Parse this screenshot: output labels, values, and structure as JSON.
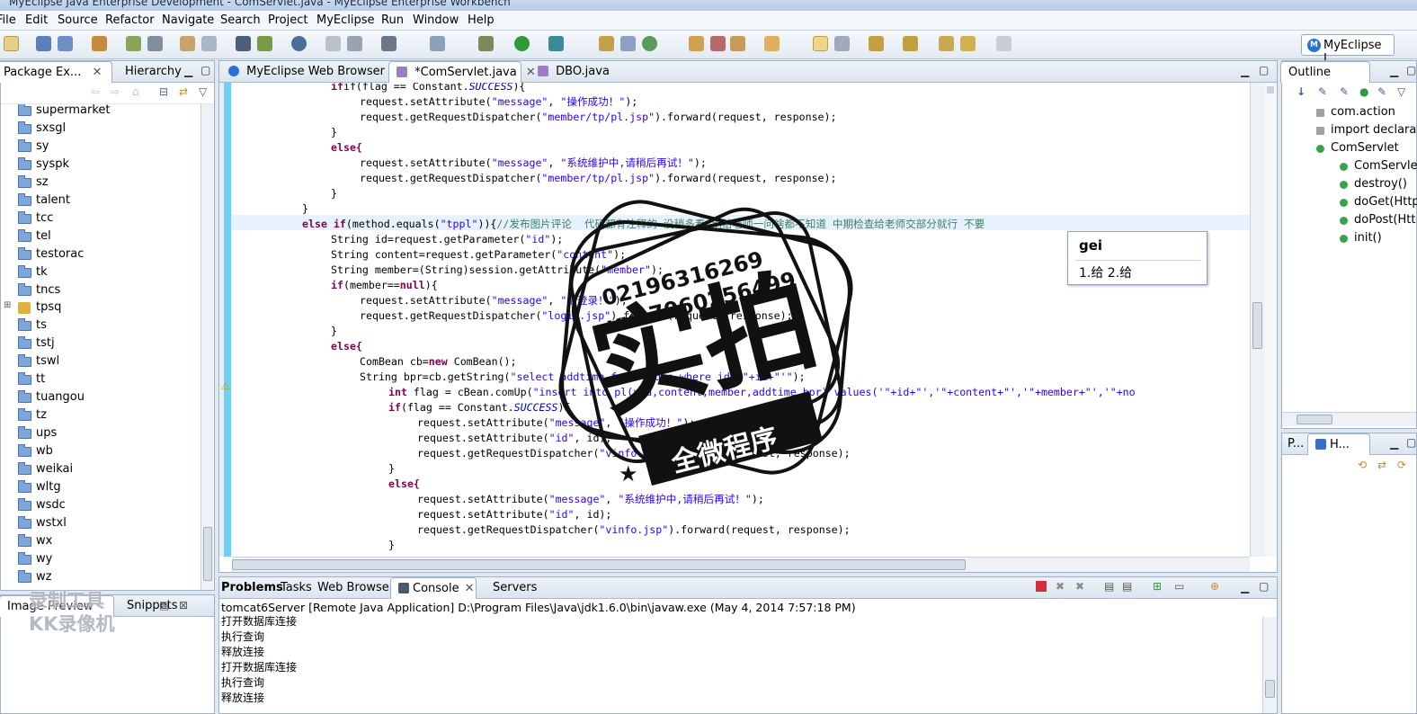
{
  "window": {
    "title": "MyEclipse Java Enterprise Development - ComServlet.java - MyEclipse Enterprise Workbench"
  },
  "menu": [
    "File",
    "Edit",
    "Source",
    "Refactor",
    "Navigate",
    "Search",
    "Project",
    "MyEclipse",
    "Run",
    "Window",
    "Help"
  ],
  "perspective": {
    "label": "MyEclipse J...",
    "icon": "M"
  },
  "left_tabs": {
    "package_explorer": "Package Ex...",
    "hierarchy": "Hierarchy"
  },
  "tree_items": [
    {
      "label": "supermarket"
    },
    {
      "label": "sxsgl"
    },
    {
      "label": "sy"
    },
    {
      "label": "syspk"
    },
    {
      "label": "sz"
    },
    {
      "label": "talent"
    },
    {
      "label": "tcc"
    },
    {
      "label": "tel"
    },
    {
      "label": "testorac"
    },
    {
      "label": "tk"
    },
    {
      "label": "tncs"
    },
    {
      "label": "tpsq"
    },
    {
      "label": "ts"
    },
    {
      "label": "tstj"
    },
    {
      "label": "tswl"
    },
    {
      "label": "tt"
    },
    {
      "label": "tuangou"
    },
    {
      "label": "tz"
    },
    {
      "label": "ups"
    },
    {
      "label": "wb"
    },
    {
      "label": "weikai"
    },
    {
      "label": "wltg"
    },
    {
      "label": "wsdc"
    },
    {
      "label": "wstxl"
    },
    {
      "label": "wx"
    },
    {
      "label": "wy"
    },
    {
      "label": "wz"
    }
  ],
  "bottom_left_tabs": {
    "image_preview": "Image Preview",
    "snippets": "Snippets"
  },
  "editor_tabs": [
    {
      "label": "MyEclipse Web Browser"
    },
    {
      "label": "*ComServlet.java"
    },
    {
      "label": "DBO.java"
    }
  ],
  "code": {
    "l1a": "if(flag == Constant.",
    "l1b": "SUCCESS",
    "l1c": "){",
    "l2a": "request.setAttribute(",
    "l2b": "\"message\"",
    "l2c": ", ",
    "l2d": "\"操作成功！\"",
    "l2e": ");",
    "l3a": "request.getRequestDispatcher(",
    "l3b": "\"member/tp/pl.jsp\"",
    "l3c": ").forward(request, response);",
    "l4": "}",
    "l5": "else{",
    "l6a": "request.setAttribute(",
    "l6b": "\"message\"",
    "l6c": ", ",
    "l6d": "\"系统维护中,请稍后再试！\"",
    "l6e": ");",
    "l7a": "request.getRequestDispatcher(",
    "l7b": "\"member/tp/pl.jsp\"",
    "l7c": ").forward(request, response);",
    "l8": "}",
    "l9": "}",
    "l10a": "else if",
    "l10b": "(method.equals(",
    "l10c": "\"tppl\"",
    "l10d": ")){",
    "l10e": "//发布图片评论  代码都有注释的 没稍多看 别给老师一问啥都不知道 中期检查给老师交部分就行 不要",
    "l11a": "String id=request.getParameter(",
    "l11b": "\"id\"",
    "l11c": ");",
    "l12a": "String content=request.getParameter(",
    "l12b": "\"content\"",
    "l12c": ");",
    "l13a": "String member=(String)session.getAttribute(",
    "l13b": "\"member\"",
    "l13c": ");",
    "l14a": "if",
    "l14b": "(member==",
    "l14c": "null",
    "l14d": "){",
    "l15a": "request.setAttribute(",
    "l15b": "\"message\"",
    "l15c": ", ",
    "l15d": "\"请登录！\"",
    "l15e": ");",
    "l16a": "request.getRequestDispatcher(",
    "l16b": "\"login.jsp\"",
    "l16c": ").forward(request, response);",
    "l17": "}",
    "l18": "else{",
    "l19a": "ComBean cb=",
    "l19b": "new",
    "l19c": " ComBean();",
    "l20a": "String bpr=cb.getString(",
    "l20b": "\"select addtime from video where id='\"+id+\"'\"",
    "l20c": ");",
    "l21a": "int",
    "l21b": " flag = cBean.comUp(",
    "l21c": "\"insert into pl(vid,content,member,addtime,bpr) values('\"+id+\"','\"+content+\"','\"+member+\"','\"+no",
    "l22a": "if",
    "l22b": "(flag == Constant.",
    "l22c": "SUCCESS",
    "l22d": "){",
    "l23a": "request.setAttribute(",
    "l23b": "\"message\"",
    "l23c": ", ",
    "l23d": "\"操作成功！\"",
    "l23e": ");",
    "l24a": "request.setAttribute(",
    "l24b": "\"id\"",
    "l24c": ", id);",
    "l25a": "request.getRequestDispatcher(",
    "l25b": "\"vinfo.jsp\"",
    "l25c": ").forward(request, response);",
    "l26": "}",
    "l27": "else{",
    "l28a": "request.setAttribute(",
    "l28b": "\"message\"",
    "l28c": ", ",
    "l28d": "\"系统维护中,请稍后再试！\"",
    "l28e": ");",
    "l29a": "request.setAttribute(",
    "l29b": "\"id\"",
    "l29c": ", id);",
    "l30a": "request.getRequestDispatcher(",
    "l30b": "\"vinfo.jsp\"",
    "l30c": ").forward(request, response);",
    "l31": "}"
  },
  "ime": {
    "input": "gei",
    "candidates": "1.给 2.给"
  },
  "outline": {
    "tabs": {
      "outline": "Outline",
      "p": "P...",
      "h": "H..."
    },
    "items": [
      {
        "label": "com.action"
      },
      {
        "label": "import declarat"
      },
      {
        "label": "ComServlet"
      },
      {
        "label": "ComServle"
      },
      {
        "label": "destroy()"
      },
      {
        "label": "doGet(Http"
      },
      {
        "label": "doPost(Htt"
      },
      {
        "label": "init()"
      }
    ]
  },
  "console": {
    "tabs": [
      "Problems",
      "Tasks",
      "Web Browser",
      "Console",
      "Servers"
    ],
    "header": "tomcat6Server [Remote Java Application] D:\\Program Files\\Java\\jdk1.6.0\\bin\\javaw.exe (May 4, 2014 7:57:18 PM)",
    "lines": [
      "打开数据库连接",
      "执行查询",
      "释放连接",
      "打开数据库连接",
      "执行查询",
      "释放连接"
    ]
  },
  "watermark": {
    "phone1": "02196316269",
    "phone2": "vx17060256499",
    "big": "实拍",
    "banner": "全微程序",
    "corner": "录制工具 KK录像机"
  },
  "colors": {
    "accent": "#2a6fd6",
    "keyword": "#7f0055",
    "string": "#2a00ff",
    "comment": "#3f7f5f"
  }
}
